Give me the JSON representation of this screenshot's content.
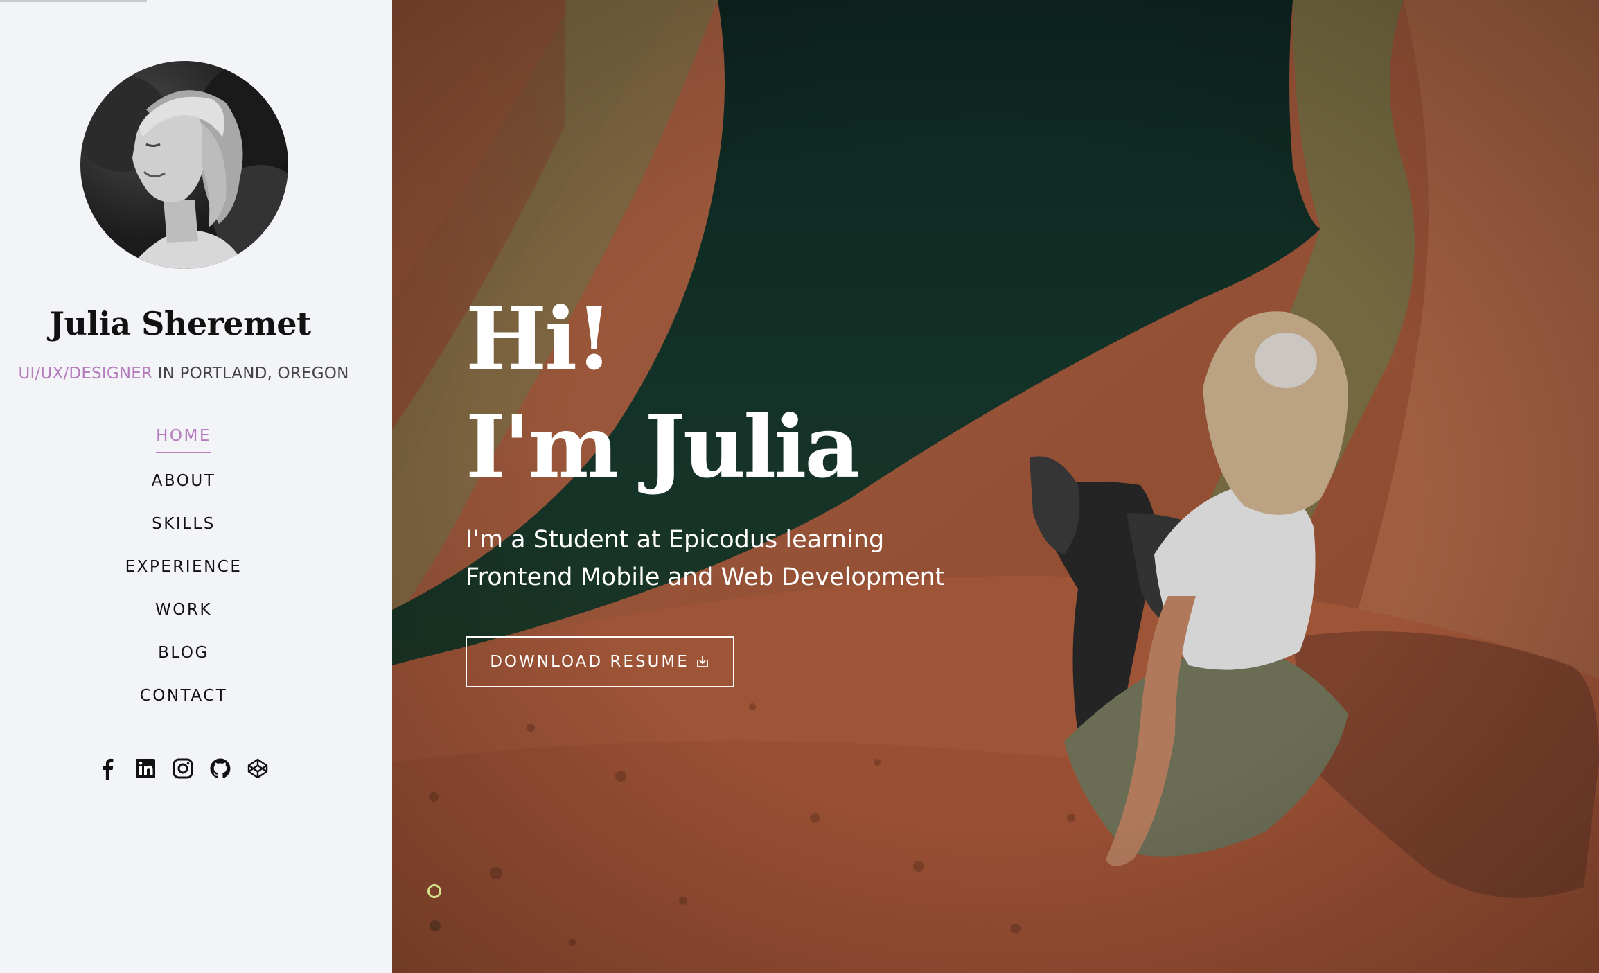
{
  "profile": {
    "name": "Julia Sheremet",
    "role": "UI/UX/DESIGNER",
    "location": " IN PORTLAND, OREGON"
  },
  "nav": {
    "items": [
      {
        "label": "HOME",
        "active": true
      },
      {
        "label": "ABOUT"
      },
      {
        "label": "SKILLS"
      },
      {
        "label": "EXPERIENCE"
      },
      {
        "label": "WORK"
      },
      {
        "label": "BLOG"
      },
      {
        "label": "CONTACT"
      }
    ]
  },
  "social": {
    "icons": [
      "facebook-icon",
      "linkedin-icon",
      "instagram-icon",
      "github-icon",
      "codepen-icon"
    ]
  },
  "hero": {
    "title_line1": "Hi!",
    "title_line2": "I'm Julia",
    "subtitle_line1": "I'm a Student at Epicodus learning",
    "subtitle_line2": "Frontend Mobile and Web Development",
    "button_label": "DOWNLOAD RESUME"
  },
  "colors": {
    "accent": "#b57bbd",
    "sidebar_bg": "#f3f4f8",
    "scroll_indicator": "#d7e08a"
  }
}
